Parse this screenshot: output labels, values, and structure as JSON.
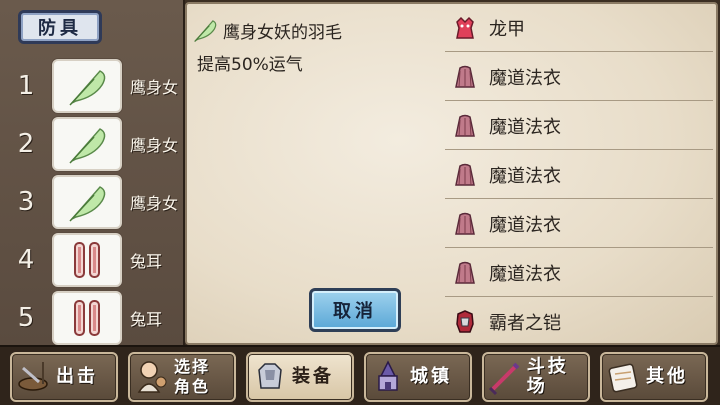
{
  "category_tab": {
    "label": "防具"
  },
  "slots": [
    {
      "num": "1",
      "icon": "feather-icon",
      "label": "鹰身女"
    },
    {
      "num": "2",
      "icon": "feather-icon",
      "label": "鹰身女"
    },
    {
      "num": "3",
      "icon": "feather-icon",
      "label": "鹰身女"
    },
    {
      "num": "4",
      "icon": "bunny-ears-icon",
      "label": "兔耳"
    },
    {
      "num": "5",
      "icon": "bunny-ears-icon",
      "label": "兔耳"
    }
  ],
  "detail": {
    "title": "鹰身女妖的羽毛",
    "description": "提高50%运气",
    "icon": "feather-icon"
  },
  "cancel_button": {
    "label": "取消"
  },
  "item_list": [
    {
      "icon": "dragon-armor-icon",
      "label": "龙甲"
    },
    {
      "icon": "robe-icon",
      "label": "魔道法衣"
    },
    {
      "icon": "robe-icon",
      "label": "魔道法衣"
    },
    {
      "icon": "robe-icon",
      "label": "魔道法衣"
    },
    {
      "icon": "robe-icon",
      "label": "魔道法衣"
    },
    {
      "icon": "robe-icon",
      "label": "魔道法衣"
    },
    {
      "icon": "overlord-armor-icon",
      "label": "霸者之铠"
    }
  ],
  "bottom_nav": [
    {
      "icon": "sortie-icon",
      "label": "出击",
      "line2": ""
    },
    {
      "icon": "character-icon",
      "label": "选择",
      "line2": "角色"
    },
    {
      "icon": "equipment-icon",
      "label": "装备",
      "line2": "",
      "active": true
    },
    {
      "icon": "town-icon",
      "label": "城镇",
      "line2": ""
    },
    {
      "icon": "arena-icon",
      "label": "斗技场",
      "line2": ""
    },
    {
      "icon": "other-icon",
      "label": "其他",
      "line2": ""
    }
  ],
  "colors": {
    "panel_bg": "#5a4b3f",
    "parchment": "#eee5d4",
    "cancel_button": "#7cbde3",
    "tab_border": "#2f3a58"
  }
}
